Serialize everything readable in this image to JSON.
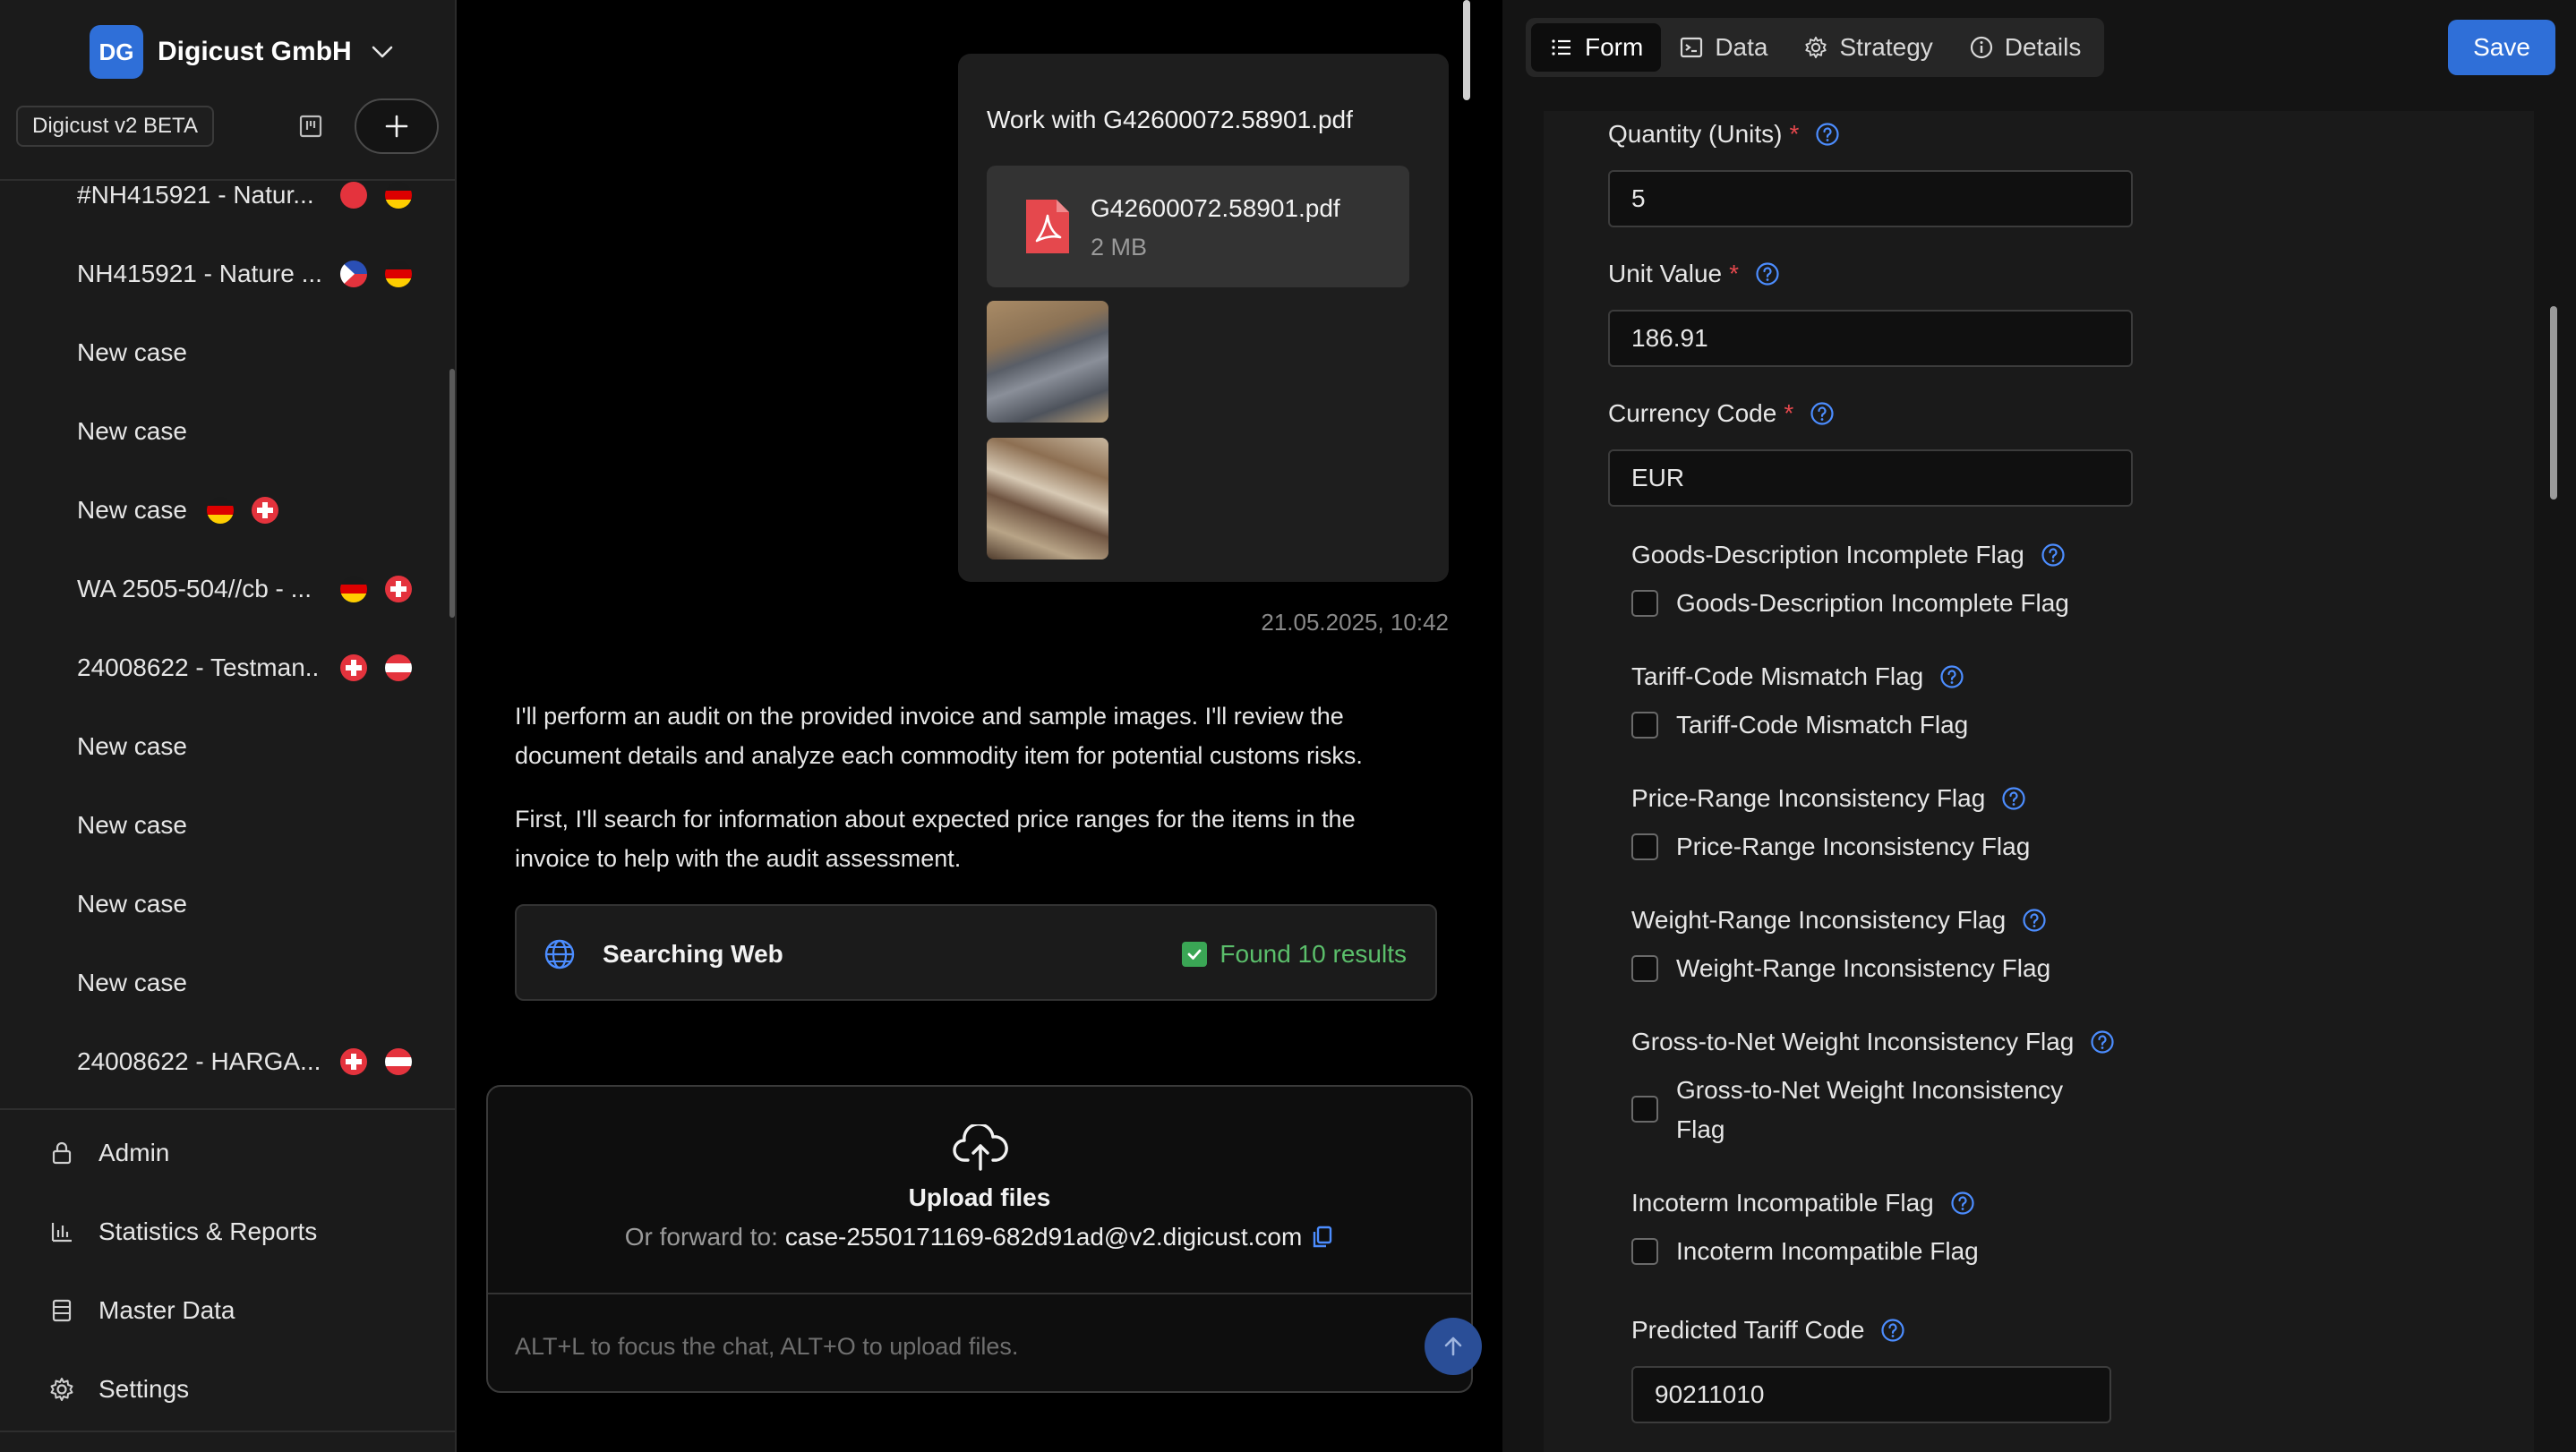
{
  "sidebar": {
    "org": {
      "initials": "DG",
      "name": "Digicust GmbH"
    },
    "version_badge": "Digicust v2 BETA",
    "cases": [
      {
        "label": "#NH415921 - Natur...",
        "flags": [
          "red",
          "de"
        ]
      },
      {
        "label": "NH415921 - Nature ...",
        "flags": [
          "ph",
          "de"
        ]
      },
      {
        "label": "New case",
        "flags": []
      },
      {
        "label": "New case",
        "flags": []
      },
      {
        "label": "New case",
        "flags": [
          "de",
          "ch"
        ]
      },
      {
        "label": "WA 2505-504//cb - ...",
        "flags": [
          "de",
          "ch"
        ]
      },
      {
        "label": "24008622 - Testman...",
        "flags": [
          "ch",
          "at"
        ]
      },
      {
        "label": "New case",
        "flags": []
      },
      {
        "label": "New case",
        "flags": []
      },
      {
        "label": "New case",
        "flags": []
      },
      {
        "label": "New case",
        "flags": []
      },
      {
        "label": "24008622 - HARGA...",
        "flags": [
          "ch",
          "at"
        ]
      }
    ],
    "nav": {
      "admin": "Admin",
      "stats": "Statistics & Reports",
      "master": "Master Data",
      "settings": "Settings"
    }
  },
  "chat": {
    "user_message": {
      "text": "Work with G42600072.58901.pdf",
      "file_name": "G42600072.58901.pdf",
      "file_size": "2 MB"
    },
    "timestamp": "21.05.2025, 10:42",
    "assistant_p1": "I'll perform an audit on the provided invoice and sample images. I'll review the document details and analyze each commodity item for potential customs risks.",
    "assistant_p2": "First, I'll search for information about expected price ranges for the items in the invoice to help with the audit assessment.",
    "search": {
      "title": "Searching Web",
      "result": "Found 10 results"
    },
    "upload": {
      "title": "Upload files",
      "forward_label": "Or forward to:",
      "email": "case-2550171169-682d91ad@v2.digicust.com"
    },
    "input_placeholder": "ALT+L to focus the chat, ALT+O to upload files."
  },
  "panel": {
    "tabs": {
      "form": "Form",
      "data": "Data",
      "strategy": "Strategy",
      "details": "Details"
    },
    "save_label": "Save",
    "fields": {
      "quantity": {
        "label": "Quantity (Units)",
        "required": "*",
        "value": "5"
      },
      "unit_value": {
        "label": "Unit Value",
        "required": "*",
        "value": "186.91"
      },
      "currency": {
        "label": "Currency Code",
        "required": "*",
        "value": "EUR"
      },
      "goods_desc": {
        "label": "Goods-Description Incomplete Flag",
        "checkbox": "Goods-Description Incomplete Flag"
      },
      "tariff_mismatch": {
        "label": "Tariff-Code Mismatch Flag",
        "checkbox": "Tariff-Code Mismatch Flag"
      },
      "price_range": {
        "label": "Price-Range Inconsistency Flag",
        "checkbox": "Price-Range Inconsistency Flag"
      },
      "weight_range": {
        "label": "Weight-Range Inconsistency Flag",
        "checkbox": "Weight-Range Inconsistency Flag"
      },
      "gross_net": {
        "label": "Gross-to-Net Weight Inconsistency Flag",
        "checkbox_line1": "Gross-to-Net Weight Inconsistency",
        "checkbox_line2": "Flag"
      },
      "incoterm": {
        "label": "Incoterm Incompatible Flag",
        "checkbox": "Incoterm Incompatible Flag"
      },
      "tariff_code": {
        "label": "Predicted Tariff Code",
        "value": "90211010"
      }
    }
  },
  "colors": {
    "accent": "#2f6fd8",
    "success": "#5bbf6b",
    "required": "#e5484d",
    "help_icon": "#4c8dff"
  },
  "icons": {
    "org_chevron": "chevron-down-icon",
    "kanban": "kanban-icon",
    "add": "plus-icon",
    "admin": "lock-icon",
    "stats": "bar-chart-icon",
    "master": "database-icon",
    "settings": "gear-icon",
    "pdf": "pdf-file-icon",
    "globe": "globe-icon",
    "check": "check-icon",
    "upload": "cloud-upload-icon",
    "copy": "copy-icon",
    "send": "arrow-up-icon",
    "tab_form": "list-icon",
    "tab_data": "terminal-icon",
    "tab_strategy": "gear-icon",
    "tab_details": "info-icon",
    "help": "question-circle-icon"
  }
}
